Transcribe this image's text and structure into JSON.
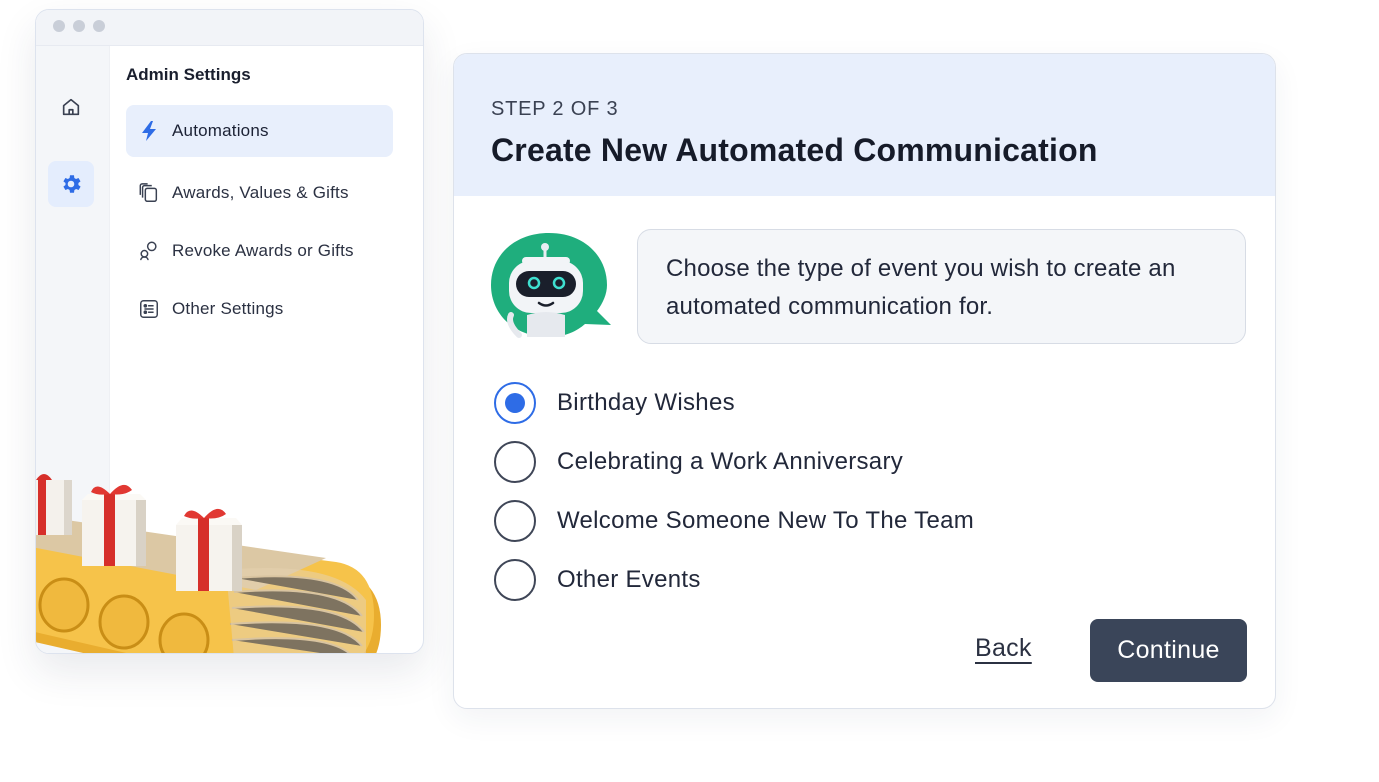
{
  "sidebar": {
    "title": "Admin Settings",
    "rail": [
      {
        "icon": "home-icon"
      },
      {
        "icon": "gear-icon",
        "active": true
      }
    ],
    "items": [
      {
        "label": "Automations",
        "icon": "lightning-icon",
        "active": true
      },
      {
        "label": "Awards, Values & Gifts",
        "icon": "stack-icon"
      },
      {
        "label": "Revoke Awards or Gifts",
        "icon": "revoke-icon"
      },
      {
        "label": "Other Settings",
        "icon": "list-settings-icon"
      }
    ]
  },
  "wizard": {
    "step_label": "STEP 2 OF 3",
    "title": "Create New Automated Communication",
    "prompt": "Choose the type of event you wish to create an automated communication for.",
    "options": [
      {
        "label": "Birthday Wishes",
        "selected": true
      },
      {
        "label": "Celebrating a Work Anniversary",
        "selected": false
      },
      {
        "label": "Welcome Someone New To The Team",
        "selected": false
      },
      {
        "label": "Other Events",
        "selected": false
      }
    ],
    "back_label": "Back",
    "continue_label": "Continue"
  },
  "colors": {
    "accent": "#2e6ce6",
    "header_bg": "#e8effc",
    "primary_button": "#3a4559",
    "robot_green": "#1fae7d"
  }
}
